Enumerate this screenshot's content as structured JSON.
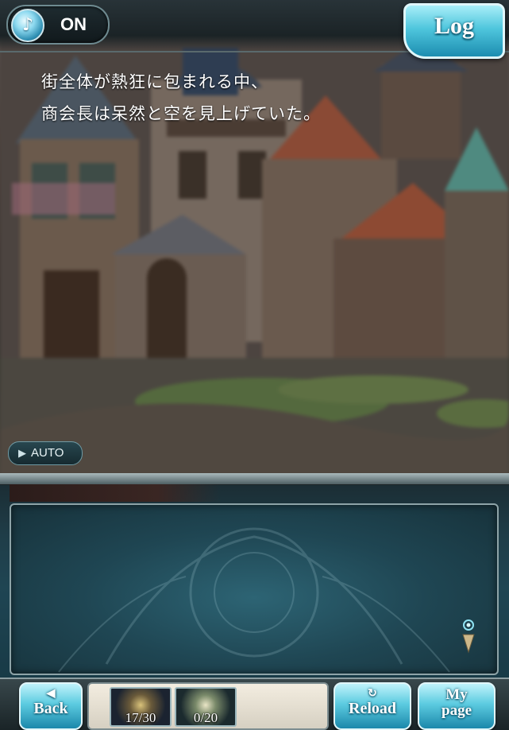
{
  "header": {
    "music_icon": "music-note-icon",
    "music_glyph": "♪",
    "music_state": "ON",
    "log_label": "Log"
  },
  "auto": {
    "icon": "play-triangle-icon",
    "glyph": "▶",
    "label": "AUTO"
  },
  "dialogue": {
    "lines": [
      "街全体が熱狂に包まれる中、",
      "商会長は呆然と空を見上げていた。"
    ]
  },
  "bottom_nav": {
    "back": {
      "icon": "back-arrow-icon",
      "glyph": "◀",
      "label": "Back"
    },
    "items": [
      {
        "icon": "potion-item-icon",
        "count": "17/30"
      },
      {
        "icon": "elixir-item-icon",
        "count": "0/20"
      }
    ],
    "reload": {
      "icon": "reload-icon",
      "glyph": "↻",
      "label": "Reload"
    },
    "mypage": {
      "label_line1": "My",
      "label_line2": "page"
    }
  },
  "colors": {
    "accent": "#4fc6dd",
    "dialog_bg": "#1f4553",
    "frame": "#8ea4a8"
  }
}
